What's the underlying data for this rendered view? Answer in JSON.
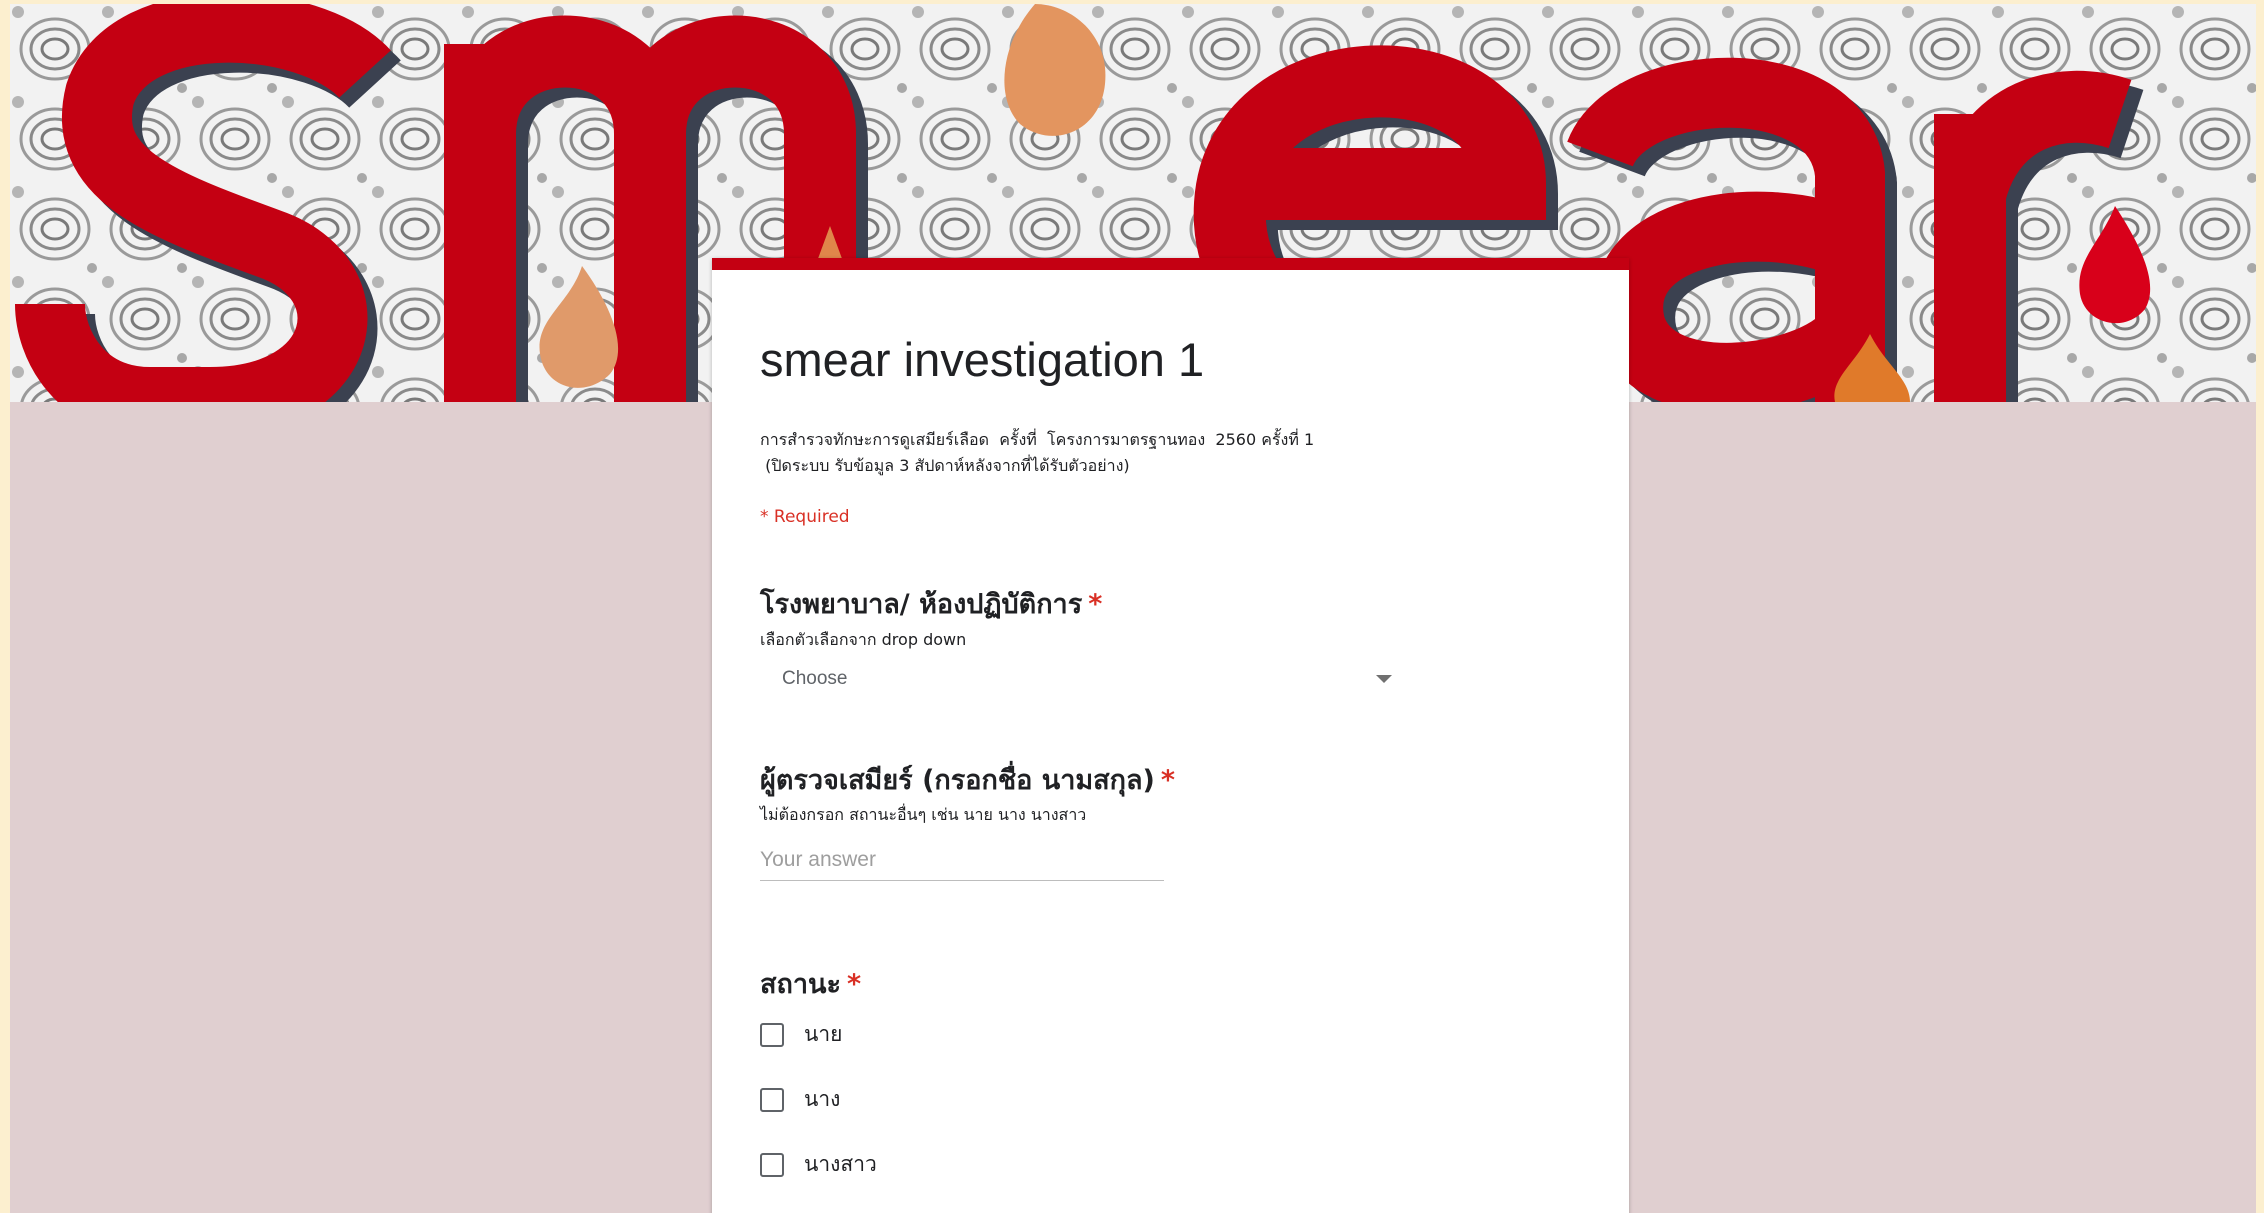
{
  "header": {
    "banner_text": "smear",
    "banner_image": "smear-blood-drops-fingerprint-banner",
    "accent_color": "#c40012",
    "background_color": "#e0cfd0"
  },
  "form": {
    "title": "smear investigation 1",
    "description_lines": [
      "การสำรวจทักษะการดูเสมียร์เลือด  ครั้งที่  โครงการมาตรฐานทอง  2560 ครั้งที่ 1",
      " (ปิดระบบ รับข้อมูล 3 สัปดาห์หลังจากที่ได้รับตัวอย่าง)"
    ],
    "required_note": "* Required"
  },
  "questions": {
    "hospital": {
      "title": "โรงพยาบาล/ ห้องปฏิบัติการ",
      "required_mark": "*",
      "help": "เลือกตัวเลือกจาก drop down",
      "dropdown_label": "Choose"
    },
    "examiner": {
      "title": "ผู้ตรวจเสมียร์ (กรอกชื่อ นามสกุล)",
      "required_mark": "*",
      "help": "ไม่ต้องกรอก สถานะอื่นๆ เช่น นาย นาง นางสาว",
      "placeholder": "Your answer",
      "value": ""
    },
    "status": {
      "title": "สถานะ",
      "required_mark": "*",
      "options": [
        {
          "label": "นาย",
          "checked": false
        },
        {
          "label": "นาง",
          "checked": false
        },
        {
          "label": "นางสาว",
          "checked": false
        }
      ]
    }
  }
}
